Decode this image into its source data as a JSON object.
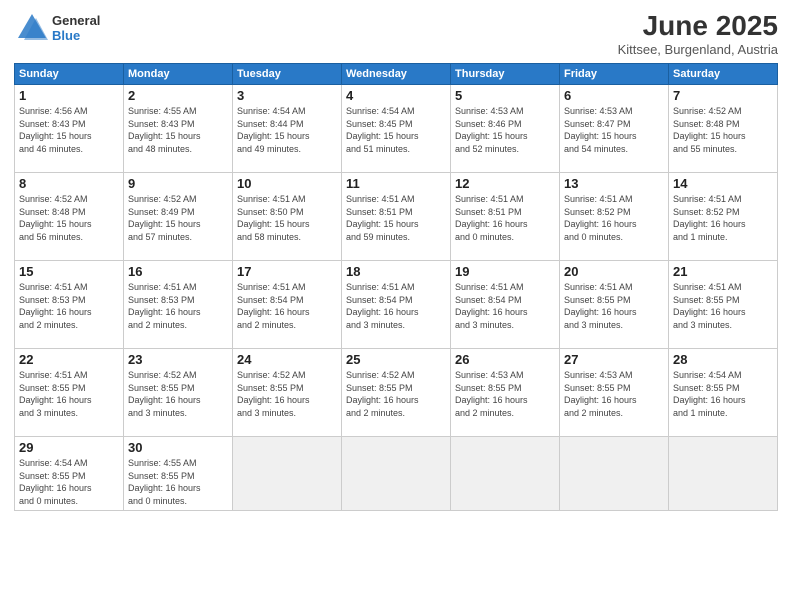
{
  "logo": {
    "general": "General",
    "blue": "Blue"
  },
  "title": "June 2025",
  "location": "Kittsee, Burgenland, Austria",
  "weekdays": [
    "Sunday",
    "Monday",
    "Tuesday",
    "Wednesday",
    "Thursday",
    "Friday",
    "Saturday"
  ],
  "weeks": [
    [
      {
        "day": "1",
        "info": "Sunrise: 4:56 AM\nSunset: 8:43 PM\nDaylight: 15 hours\nand 46 minutes."
      },
      {
        "day": "2",
        "info": "Sunrise: 4:55 AM\nSunset: 8:43 PM\nDaylight: 15 hours\nand 48 minutes."
      },
      {
        "day": "3",
        "info": "Sunrise: 4:54 AM\nSunset: 8:44 PM\nDaylight: 15 hours\nand 49 minutes."
      },
      {
        "day": "4",
        "info": "Sunrise: 4:54 AM\nSunset: 8:45 PM\nDaylight: 15 hours\nand 51 minutes."
      },
      {
        "day": "5",
        "info": "Sunrise: 4:53 AM\nSunset: 8:46 PM\nDaylight: 15 hours\nand 52 minutes."
      },
      {
        "day": "6",
        "info": "Sunrise: 4:53 AM\nSunset: 8:47 PM\nDaylight: 15 hours\nand 54 minutes."
      },
      {
        "day": "7",
        "info": "Sunrise: 4:52 AM\nSunset: 8:48 PM\nDaylight: 15 hours\nand 55 minutes."
      }
    ],
    [
      {
        "day": "8",
        "info": "Sunrise: 4:52 AM\nSunset: 8:48 PM\nDaylight: 15 hours\nand 56 minutes."
      },
      {
        "day": "9",
        "info": "Sunrise: 4:52 AM\nSunset: 8:49 PM\nDaylight: 15 hours\nand 57 minutes."
      },
      {
        "day": "10",
        "info": "Sunrise: 4:51 AM\nSunset: 8:50 PM\nDaylight: 15 hours\nand 58 minutes."
      },
      {
        "day": "11",
        "info": "Sunrise: 4:51 AM\nSunset: 8:51 PM\nDaylight: 15 hours\nand 59 minutes."
      },
      {
        "day": "12",
        "info": "Sunrise: 4:51 AM\nSunset: 8:51 PM\nDaylight: 16 hours\nand 0 minutes."
      },
      {
        "day": "13",
        "info": "Sunrise: 4:51 AM\nSunset: 8:52 PM\nDaylight: 16 hours\nand 0 minutes."
      },
      {
        "day": "14",
        "info": "Sunrise: 4:51 AM\nSunset: 8:52 PM\nDaylight: 16 hours\nand 1 minute."
      }
    ],
    [
      {
        "day": "15",
        "info": "Sunrise: 4:51 AM\nSunset: 8:53 PM\nDaylight: 16 hours\nand 2 minutes."
      },
      {
        "day": "16",
        "info": "Sunrise: 4:51 AM\nSunset: 8:53 PM\nDaylight: 16 hours\nand 2 minutes."
      },
      {
        "day": "17",
        "info": "Sunrise: 4:51 AM\nSunset: 8:54 PM\nDaylight: 16 hours\nand 2 minutes."
      },
      {
        "day": "18",
        "info": "Sunrise: 4:51 AM\nSunset: 8:54 PM\nDaylight: 16 hours\nand 3 minutes."
      },
      {
        "day": "19",
        "info": "Sunrise: 4:51 AM\nSunset: 8:54 PM\nDaylight: 16 hours\nand 3 minutes."
      },
      {
        "day": "20",
        "info": "Sunrise: 4:51 AM\nSunset: 8:55 PM\nDaylight: 16 hours\nand 3 minutes."
      },
      {
        "day": "21",
        "info": "Sunrise: 4:51 AM\nSunset: 8:55 PM\nDaylight: 16 hours\nand 3 minutes."
      }
    ],
    [
      {
        "day": "22",
        "info": "Sunrise: 4:51 AM\nSunset: 8:55 PM\nDaylight: 16 hours\nand 3 minutes."
      },
      {
        "day": "23",
        "info": "Sunrise: 4:52 AM\nSunset: 8:55 PM\nDaylight: 16 hours\nand 3 minutes."
      },
      {
        "day": "24",
        "info": "Sunrise: 4:52 AM\nSunset: 8:55 PM\nDaylight: 16 hours\nand 3 minutes."
      },
      {
        "day": "25",
        "info": "Sunrise: 4:52 AM\nSunset: 8:55 PM\nDaylight: 16 hours\nand 2 minutes."
      },
      {
        "day": "26",
        "info": "Sunrise: 4:53 AM\nSunset: 8:55 PM\nDaylight: 16 hours\nand 2 minutes."
      },
      {
        "day": "27",
        "info": "Sunrise: 4:53 AM\nSunset: 8:55 PM\nDaylight: 16 hours\nand 2 minutes."
      },
      {
        "day": "28",
        "info": "Sunrise: 4:54 AM\nSunset: 8:55 PM\nDaylight: 16 hours\nand 1 minute."
      }
    ],
    [
      {
        "day": "29",
        "info": "Sunrise: 4:54 AM\nSunset: 8:55 PM\nDaylight: 16 hours\nand 0 minutes."
      },
      {
        "day": "30",
        "info": "Sunrise: 4:55 AM\nSunset: 8:55 PM\nDaylight: 16 hours\nand 0 minutes."
      },
      {
        "day": "",
        "info": ""
      },
      {
        "day": "",
        "info": ""
      },
      {
        "day": "",
        "info": ""
      },
      {
        "day": "",
        "info": ""
      },
      {
        "day": "",
        "info": ""
      }
    ]
  ]
}
